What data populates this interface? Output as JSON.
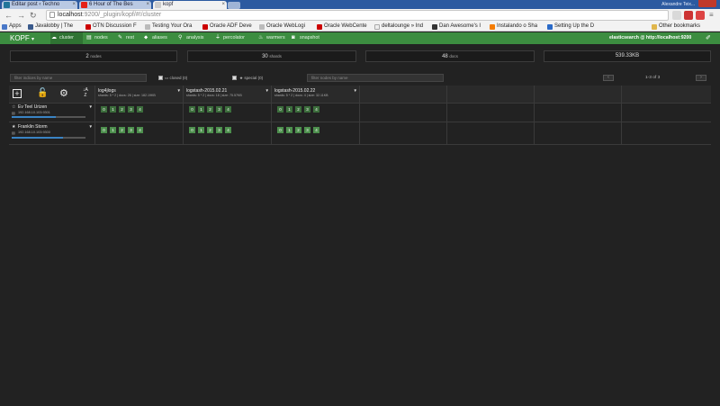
{
  "browser": {
    "tabs": [
      {
        "label": "Editar post ‹ Techno",
        "favicon": "wordpress-icon"
      },
      {
        "label": "6 Hour of The Bes",
        "favicon": "youtube-icon"
      },
      {
        "label": "kopf",
        "favicon": "page-icon"
      }
    ],
    "window_user": "Alexandre Teix...",
    "url": "localhost:9200/_plugin/kopf/#!/cluster",
    "url_host": "localhost",
    "url_rest": ":9200/_plugin/kopf/#!/cluster",
    "bookmarks": [
      "Apps",
      "Javalobby | The",
      "OTN Discussion F",
      "Testing Your Ora",
      "Oracle ADF Deve",
      "Oracle WebLogi",
      "Oracle WebCente",
      "deltalounge » Ind",
      "Dan Awesome's I",
      "Instalando o Sha",
      "Setting Up the D"
    ],
    "other_bookmarks": "Other bookmarks"
  },
  "kopf": {
    "brand": "KOPF",
    "nav": [
      {
        "label": "cluster",
        "icon": "cloud-icon"
      },
      {
        "label": "nodes",
        "icon": "server-icon"
      },
      {
        "label": "rest",
        "icon": "edit-icon"
      },
      {
        "label": "aliases",
        "icon": "tags-icon"
      },
      {
        "label": "analysis",
        "icon": "magnifier-icon"
      },
      {
        "label": "percolator",
        "icon": "filter-icon"
      },
      {
        "label": "warmers",
        "icon": "fire-icon"
      },
      {
        "label": "snapshot",
        "icon": "camera-icon"
      }
    ],
    "es_url": "elasticsearch @ http://localhost:9200",
    "stats": [
      {
        "value": "2",
        "unit": "nodes"
      },
      {
        "value": "30",
        "unit": "shards"
      },
      {
        "value": "48",
        "unit": "docs"
      },
      {
        "value": "539.33KB",
        "unit": ""
      }
    ],
    "filters": {
      "indices_placeholder": "filter indices by name",
      "closed_label": "closed (0)",
      "special_label": "special (0)",
      "nodes_placeholder": "filter nodes by name",
      "pagination": "1-3 of 3",
      "prev": "‹",
      "next": "›"
    },
    "indices": [
      {
        "name": "log4jlogs",
        "info": "shards: 5 * 2 | docs: 26 | size: 182.19KB"
      },
      {
        "name": "logstash-2015.02.21",
        "info": "shards: 5 * 2 | docs: 18 | size: 75.57KB"
      },
      {
        "name": "logstash-2015.02.22",
        "info": "shards: 5 * 2 | docs: 4 | size: 32.11KB"
      }
    ],
    "nodes": [
      {
        "name": "Ev Teel Urizen",
        "ip": "192.168.10.103:9301",
        "role": "star-outline-icon",
        "heap": 0.6
      },
      {
        "name": "Franklin Storm",
        "ip": "192.168.10.103:9300",
        "role": "star-icon",
        "heap": 0.7
      }
    ],
    "shard_ids": [
      "0",
      "1",
      "2",
      "3",
      "4"
    ]
  }
}
